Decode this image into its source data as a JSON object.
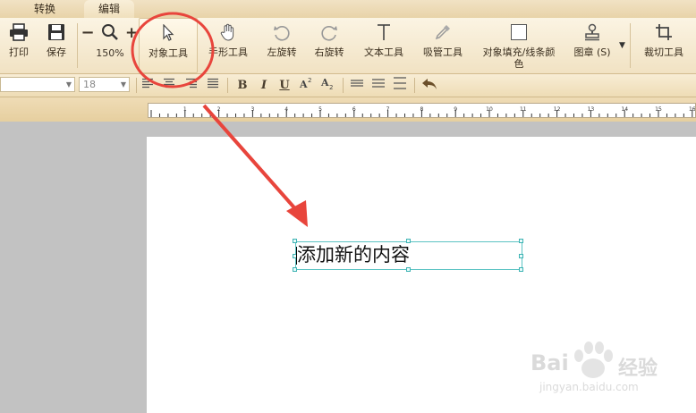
{
  "tabs": [
    "转换",
    "编辑"
  ],
  "toolbar": {
    "print": "打印",
    "save": "保存",
    "zoom_minus": "−",
    "zoom_plus": "+",
    "zoom_level": "150%",
    "object_tool": "对象工具",
    "hand_tool": "手形工具",
    "rotate_left": "左旋转",
    "rotate_right": "右旋转",
    "text_tool": "文本工具",
    "eyedropper_tool": "吸管工具",
    "fill_line_color_1": "对象填充/线条颜",
    "fill_line_color_2": "色",
    "stamp": "图章 (S)",
    "crop_tool": "裁切工具"
  },
  "format": {
    "font_family": "",
    "font_size": "18",
    "bold": "B",
    "italic": "I",
    "underline": "U"
  },
  "ruler": {
    "numbers": [
      "1",
      "2",
      "3",
      "4",
      "5",
      "6",
      "7",
      "8",
      "9",
      "10",
      "11",
      "12",
      "13",
      "14",
      "15",
      "16"
    ]
  },
  "document": {
    "text": "添加新的内容"
  },
  "watermark": {
    "brand": "Bai",
    "brand_cn": "经验",
    "url": "jingyan.baidu.com"
  },
  "colors": {
    "accent_red": "#e8453c",
    "selection": "#5cc4c4"
  }
}
